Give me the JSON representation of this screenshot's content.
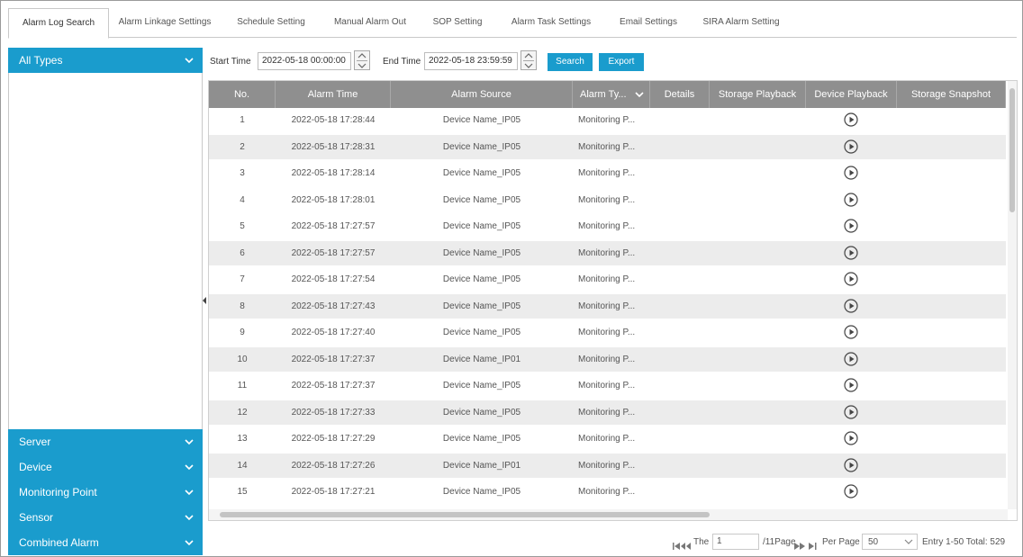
{
  "tabs": [
    {
      "label": "Alarm Log Search",
      "active": true
    },
    {
      "label": "Alarm Linkage Settings"
    },
    {
      "label": "Schedule Setting"
    },
    {
      "label": "Manual Alarm Out"
    },
    {
      "label": "SOP Setting"
    },
    {
      "label": "Alarm Task Settings"
    },
    {
      "label": "Email Settings"
    },
    {
      "label": "SIRA Alarm Setting"
    }
  ],
  "sidebar": {
    "top_panel": "All Types",
    "bottom_panels": [
      "Server",
      "Device",
      "Monitoring Point",
      "Sensor",
      "Combined Alarm"
    ]
  },
  "toolbar": {
    "start_label": "Start Time",
    "start_value": "2022-05-18 00:00:00",
    "end_label": "End Time",
    "end_value": "2022-05-18 23:59:59",
    "search_label": "Search",
    "export_label": "Export"
  },
  "table": {
    "columns": [
      "No.",
      "Alarm Time",
      "Alarm Source",
      "Alarm Ty...",
      "Details",
      "Storage Playback",
      "Device Playback",
      "Storage Snapshot"
    ],
    "rows": [
      {
        "no": "1",
        "time": "2022-05-18 17:28:44",
        "source": "Device Name_IP05",
        "type": "Monitoring P..."
      },
      {
        "no": "2",
        "time": "2022-05-18 17:28:31",
        "source": "Device Name_IP05",
        "type": "Monitoring P..."
      },
      {
        "no": "3",
        "time": "2022-05-18 17:28:14",
        "source": "Device Name_IP05",
        "type": "Monitoring P..."
      },
      {
        "no": "4",
        "time": "2022-05-18 17:28:01",
        "source": "Device Name_IP05",
        "type": "Monitoring P..."
      },
      {
        "no": "5",
        "time": "2022-05-18 17:27:57",
        "source": "Device Name_IP05",
        "type": "Monitoring P..."
      },
      {
        "no": "6",
        "time": "2022-05-18 17:27:57",
        "source": "Device Name_IP05",
        "type": "Monitoring P..."
      },
      {
        "no": "7",
        "time": "2022-05-18 17:27:54",
        "source": "Device Name_IP05",
        "type": "Monitoring P..."
      },
      {
        "no": "8",
        "time": "2022-05-18 17:27:43",
        "source": "Device Name_IP05",
        "type": "Monitoring P..."
      },
      {
        "no": "9",
        "time": "2022-05-18 17:27:40",
        "source": "Device Name_IP05",
        "type": "Monitoring P..."
      },
      {
        "no": "10",
        "time": "2022-05-18 17:27:37",
        "source": "Device Name_IP01",
        "type": "Monitoring P..."
      },
      {
        "no": "11",
        "time": "2022-05-18 17:27:37",
        "source": "Device Name_IP05",
        "type": "Monitoring P..."
      },
      {
        "no": "12",
        "time": "2022-05-18 17:27:33",
        "source": "Device Name_IP05",
        "type": "Monitoring P..."
      },
      {
        "no": "13",
        "time": "2022-05-18 17:27:29",
        "source": "Device Name_IP05",
        "type": "Monitoring P..."
      },
      {
        "no": "14",
        "time": "2022-05-18 17:27:26",
        "source": "Device Name_IP01",
        "type": "Monitoring P..."
      },
      {
        "no": "15",
        "time": "2022-05-18 17:27:21",
        "source": "Device Name_IP05",
        "type": "Monitoring P..."
      }
    ],
    "selected_row": "4"
  },
  "pager": {
    "the_label": "The",
    "page_value": "1",
    "page_suffix": "/11Page",
    "per_page_label": "Per Page",
    "per_page_value": "50",
    "entry_text": "Entry 1-50 Total: 529"
  },
  "colors": {
    "accent": "#1a9ccd",
    "header": "#8f8f8f",
    "alt_row": "#ececec"
  }
}
